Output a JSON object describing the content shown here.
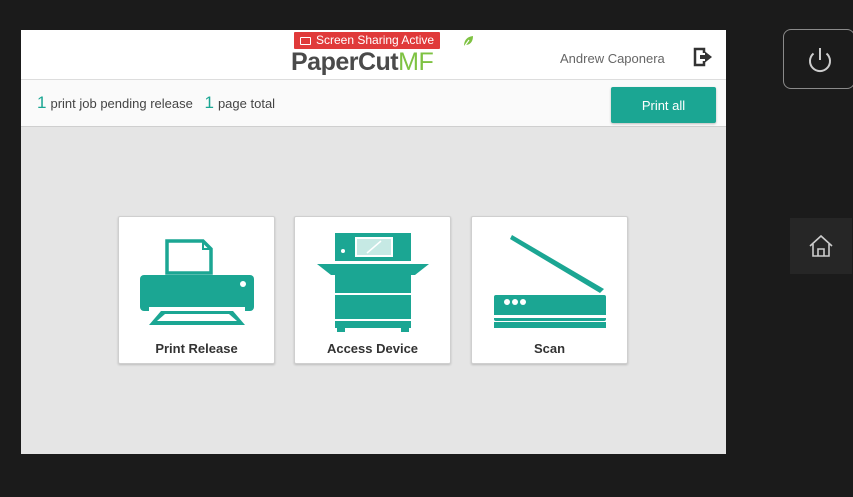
{
  "header": {
    "banner": "Screen Sharing Active",
    "logo_main": "PaperCut",
    "logo_suffix": "MF",
    "user_name": "Andrew Caponera"
  },
  "status": {
    "job_count": "1",
    "job_text": "print job pending release",
    "page_count": "1",
    "page_text": "page total",
    "print_all_label": "Print all"
  },
  "tiles": [
    {
      "label": "Print Release",
      "icon": "printer-icon"
    },
    {
      "label": "Access Device",
      "icon": "copier-icon"
    },
    {
      "label": "Scan",
      "icon": "scanner-icon"
    }
  ],
  "device": {
    "power_icon": "power-icon",
    "home_icon": "home-icon"
  },
  "colors": {
    "accent": "#1ba693",
    "banner": "#e03a3a",
    "logo_green": "#7ec242",
    "bezel": "#1b1b1b",
    "background": "#e5e5e5"
  }
}
